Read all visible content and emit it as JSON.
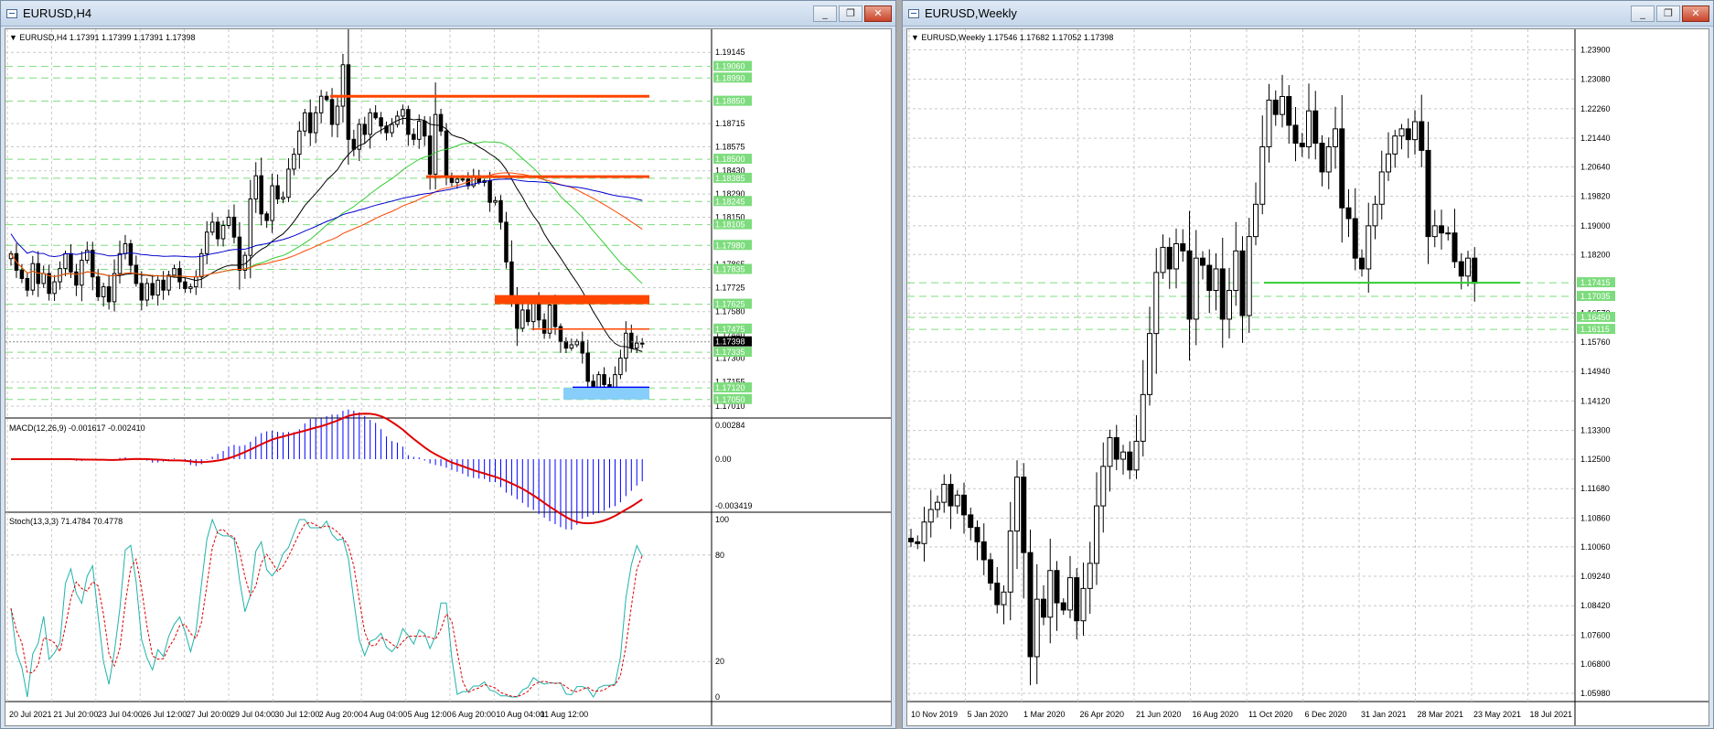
{
  "windows": {
    "left": {
      "title": "EURUSD,H4",
      "minimize": "_",
      "restore": "❐",
      "close": "✕"
    },
    "right": {
      "title": "EURUSD,Weekly",
      "minimize": "_",
      "restore": "❐",
      "close": "✕"
    }
  },
  "colors": {
    "up": "#ffffff",
    "down": "#000000",
    "grid": "#c8c8c8",
    "level": "#7ddc7d",
    "resistance": "#ff4500",
    "support": "#0000ff",
    "support_zone": "#87cefa",
    "ma_black": "#000000",
    "ma_green": "#32cd32",
    "ma_orange": "#ff4500",
    "ma_blue": "#0000cd",
    "macd_hist": "#0000ff",
    "macd_signal": "#e00000",
    "stoch_main": "#20b2aa",
    "stoch_signal": "#e00000"
  },
  "chart_data": [
    {
      "type": "candlestick",
      "symbol_label": "EURUSD,H4",
      "ohlc_label": "1.17391 1.17399 1.17391 1.17398",
      "ylim": [
        1.1701,
        1.1924
      ],
      "y_ticks": [
        "1.19145",
        "1.18715",
        "1.18575",
        "1.18430",
        "1.18290",
        "1.18150",
        "1.17865",
        "1.17725",
        "1.17580",
        "1.17440",
        "1.17300",
        "1.17155",
        "1.17010"
      ],
      "level_labels": [
        "1.19060",
        "1.18990",
        "1.18850",
        "1.18500",
        "1.18385",
        "1.18245",
        "1.18105",
        "1.17980",
        "1.17835",
        "1.17625",
        "1.17475",
        "1.17335",
        "1.17120",
        "1.17050"
      ],
      "last_price": "1.17398",
      "x_labels": [
        "20 Jul 2021",
        "21 Jul 20:00",
        "23 Jul 04:00",
        "26 Jul 12:00",
        "27 Jul 20:00",
        "29 Jul 04:00",
        "30 Jul 12:00",
        "2 Aug 20:00",
        "4 Aug 04:00",
        "5 Aug 12:00",
        "6 Aug 20:00",
        "10 Aug 04:00",
        "11 Aug 12:00"
      ],
      "close": [
        1.1793,
        1.1783,
        1.1778,
        1.1771,
        1.1787,
        1.1775,
        1.1781,
        1.1769,
        1.1776,
        1.1784,
        1.1793,
        1.1782,
        1.1774,
        1.1789,
        1.1795,
        1.1779,
        1.1767,
        1.1773,
        1.1764,
        1.1781,
        1.1793,
        1.1799,
        1.1786,
        1.1775,
        1.1765,
        1.1775,
        1.1768,
        1.1777,
        1.1771,
        1.178,
        1.1784,
        1.1776,
        1.1772,
        1.1773,
        1.1779,
        1.1793,
        1.1806,
        1.1812,
        1.1802,
        1.181,
        1.1815,
        1.1803,
        1.1783,
        1.1792,
        1.1826,
        1.184,
        1.1817,
        1.1813,
        1.1834,
        1.1826,
        1.1827,
        1.1844,
        1.1853,
        1.1867,
        1.1878,
        1.1866,
        1.1878,
        1.1888,
        1.1886,
        1.1871,
        1.1882,
        1.1907,
        1.1862,
        1.1856,
        1.1871,
        1.1865,
        1.1878,
        1.1875,
        1.187,
        1.1866,
        1.1871,
        1.1876,
        1.188,
        1.1865,
        1.1862,
        1.1873,
        1.1864,
        1.1841,
        1.1877,
        1.1867,
        1.1839,
        1.1836,
        1.1838,
        1.1838,
        1.1834,
        1.184,
        1.1836,
        1.1837,
        1.1824,
        1.1825,
        1.1812,
        1.1788,
        1.1765,
        1.1748,
        1.1759,
        1.1752,
        1.1763,
        1.1753,
        1.1745,
        1.1762,
        1.1749,
        1.174,
        1.1736,
        1.1738,
        1.174,
        1.1733,
        1.1716,
        1.1712,
        1.172,
        1.1714,
        1.1711,
        1.172,
        1.173,
        1.1745,
        1.1736,
        1.1739,
        1.1739
      ],
      "series": [
        {
          "name": "",
          "kind": "ma_black"
        },
        {
          "name": "",
          "kind": "ma_green"
        },
        {
          "name": "",
          "kind": "ma_orange"
        },
        {
          "name": "",
          "kind": "ma_blue"
        }
      ],
      "horizontal_levels": [
        {
          "price": 1.1888,
          "style": "resistance"
        },
        {
          "price": 1.18395,
          "style": "resistance"
        },
        {
          "price": 1.1768,
          "style": "resistance_zone",
          "to": 1.17625
        },
        {
          "price": 1.17475,
          "style": "resistance"
        },
        {
          "price": 1.1712,
          "style": "support"
        },
        {
          "price": 1.1712,
          "style": "support_zone",
          "to": 1.1705
        }
      ],
      "macd": {
        "label": "MACD(12,26,9) -0.001617 -0.002410",
        "y_ticks": [
          "0.00284",
          "0.00",
          "-0.003419"
        ]
      },
      "stoch": {
        "label": "Stoch(13,3,3) 71.4784 70.4778",
        "y_ticks": [
          "100",
          "80",
          "20",
          "0"
        ]
      }
    },
    {
      "type": "candlestick",
      "symbol_label": "EURUSD,Weekly",
      "ohlc_label": "1.17546 1.17682 1.17052 1.17398",
      "ylim": [
        1.0598,
        1.2432
      ],
      "y_ticks": [
        "1.23900",
        "1.23080",
        "1.22260",
        "1.21440",
        "1.20640",
        "1.19820",
        "1.19000",
        "1.18200",
        "1.16570",
        "1.15760",
        "1.14940",
        "1.14120",
        "1.13300",
        "1.12500",
        "1.11680",
        "1.10860",
        "1.10060",
        "1.09240",
        "1.08420",
        "1.07600",
        "1.06800",
        "1.05980"
      ],
      "level_labels": [
        "1.17415",
        "1.17035",
        "1.16450",
        "1.16115"
      ],
      "x_labels": [
        "10 Nov 2019",
        "5 Jan 2020",
        "1 Mar 2020",
        "26 Apr 2020",
        "21 Jun 2020",
        "16 Aug 2020",
        "11 Oct 2020",
        "6 Dec 2020",
        "31 Jan 2021",
        "28 Mar 2021",
        "23 May 2021",
        "18 Jul 2021"
      ],
      "close": [
        1.102,
        1.1015,
        1.1075,
        1.111,
        1.113,
        1.118,
        1.112,
        1.115,
        1.1095,
        1.106,
        1.102,
        1.097,
        1.0905,
        1.0845,
        1.088,
        1.105,
        1.12,
        1.099,
        1.07,
        1.086,
        1.081,
        1.094,
        1.085,
        1.083,
        1.092,
        1.08,
        1.089,
        1.096,
        1.112,
        1.123,
        1.131,
        1.125,
        1.127,
        1.122,
        1.13,
        1.143,
        1.16,
        1.177,
        1.184,
        1.178,
        1.185,
        1.183,
        1.164,
        1.181,
        1.179,
        1.172,
        1.178,
        1.164,
        1.172,
        1.183,
        1.165,
        1.187,
        1.196,
        1.212,
        1.225,
        1.221,
        1.226,
        1.218,
        1.213,
        1.212,
        1.222,
        1.213,
        1.205,
        1.212,
        1.217,
        1.195,
        1.192,
        1.181,
        1.178,
        1.19,
        1.196,
        1.205,
        1.21,
        1.215,
        1.217,
        1.214,
        1.219,
        1.211,
        1.187,
        1.19,
        1.188,
        1.188,
        1.18,
        1.176,
        1.181,
        1.174
      ],
      "horizontal_levels": [
        {
          "price": 1.17415,
          "style": "level"
        }
      ]
    }
  ]
}
